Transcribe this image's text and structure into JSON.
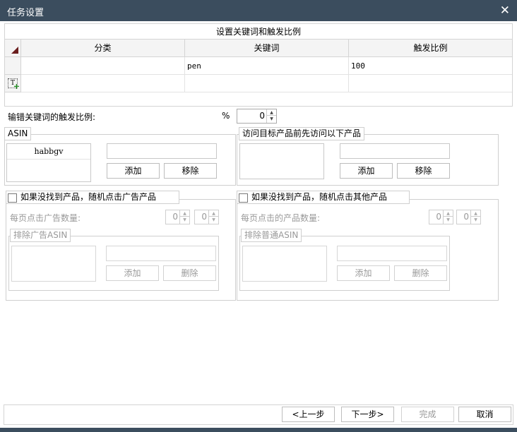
{
  "window": {
    "title": "任务设置",
    "close_icon": "close-icon"
  },
  "keyword_grid": {
    "title": "设置关键词和触发比例",
    "columns": [
      "分类",
      "关键词",
      "触发比例"
    ],
    "rows": [
      {
        "category": "",
        "keyword": "pen",
        "ratio": "100"
      }
    ]
  },
  "typo_ratio": {
    "label": "输错关键词的触发比例:",
    "unit": "%",
    "value": "0"
  },
  "asin_group": {
    "legend": "ASIN",
    "items": [
      "habbgv"
    ],
    "input_value": "",
    "add_label": "添加",
    "remove_label": "移除"
  },
  "visit_group": {
    "legend": "访问目标产品前先访问以下产品",
    "input_value": "",
    "add_label": "添加",
    "remove_label": "移除"
  },
  "ad_group": {
    "checkbox_label": "如果没找到产品，随机点击广告产品",
    "count_label": "每页点击广告数量:",
    "min_value": "0",
    "max_value": "0",
    "exclude_legend": "排除广告ASIN",
    "add_label": "添加",
    "delete_label": "删除"
  },
  "other_group": {
    "checkbox_label": "如果没找到产品，随机点击其他产品",
    "count_label": "每页点击的产品数量:",
    "min_value": "0",
    "max_value": "0",
    "exclude_legend": "排除普通ASIN",
    "add_label": "添加",
    "delete_label": "删除"
  },
  "footer": {
    "prev_label": "<上一步",
    "next_label": "下一步>",
    "finish_label": "完成",
    "cancel_label": "取消"
  }
}
